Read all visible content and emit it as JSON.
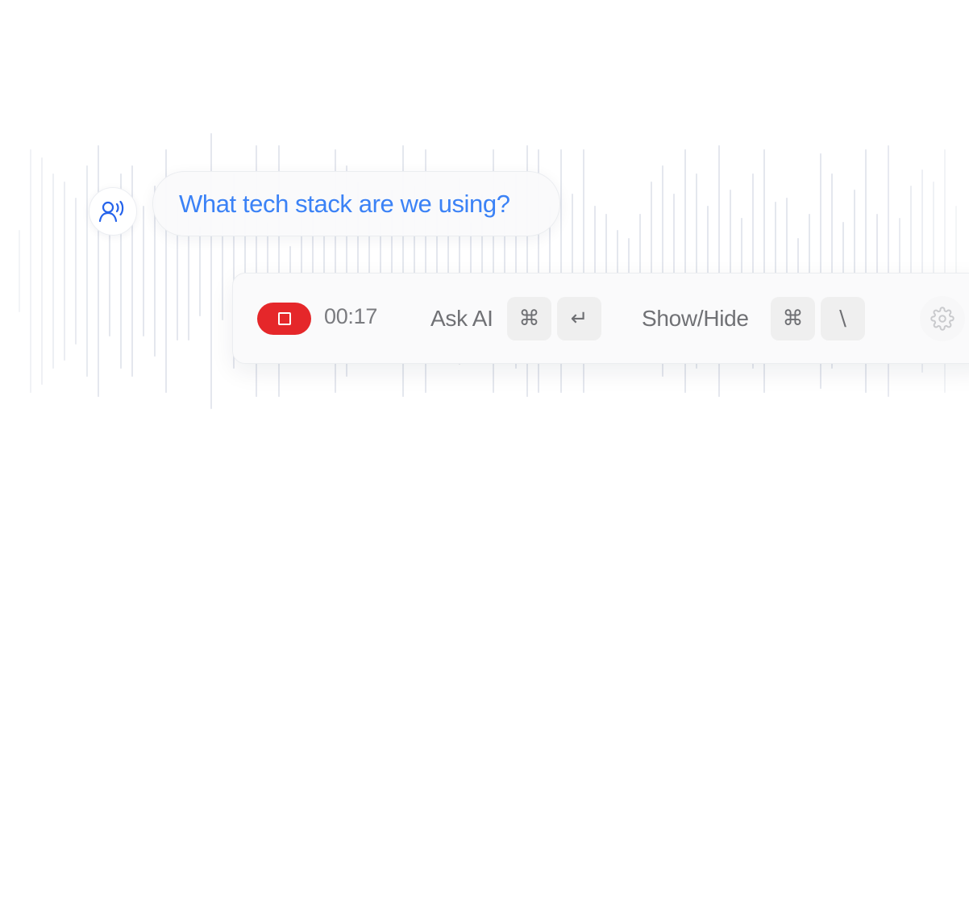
{
  "question": {
    "text": "What tech stack are we using?"
  },
  "toolbar": {
    "timer": "00:17",
    "ask_ai_label": "Ask AI",
    "ask_ai_keys": [
      "⌘",
      "↵"
    ],
    "show_hide_label": "Show/Hide",
    "show_hide_keys": [
      "⌘",
      "\\"
    ]
  },
  "icons": {
    "speaker": "speaker-voice-icon",
    "stop": "stop-icon",
    "settings": "gear-icon"
  },
  "colors": {
    "question_text": "#3b82f6",
    "record_button": "#e5272a",
    "waveform": "#e4e7ee",
    "speaker_icon": "#2563eb"
  }
}
